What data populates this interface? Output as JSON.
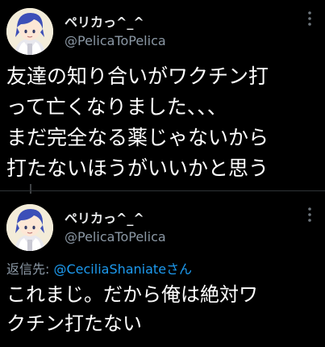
{
  "tweets": [
    {
      "display_name": "ペリカっ^_^",
      "handle": "@PelicaToPelica",
      "text_lines": [
        "友達の知り合いがワクチン打",
        "って亡くなりました、、、",
        "まだ完全なる薬じゃないから",
        "打たないほうがいいかと思う"
      ]
    },
    {
      "display_name": "ペリカっ^_^",
      "handle": "@PelicaToPelica",
      "reply_prefix": "返信先: ",
      "reply_mention": "@CeciliaShaniate",
      "reply_suffix": "さん",
      "text_lines": [
        "これまじ。だから俺は絶対ワ",
        "クチン打たない"
      ]
    }
  ],
  "icons": {
    "more": "more-options-icon",
    "avatar": "avatar-image"
  },
  "colors": {
    "background": "#000000",
    "text": "#ffffff",
    "secondary": "#8b98a5",
    "link": "#1d9bf0",
    "divider": "#2f3336"
  }
}
